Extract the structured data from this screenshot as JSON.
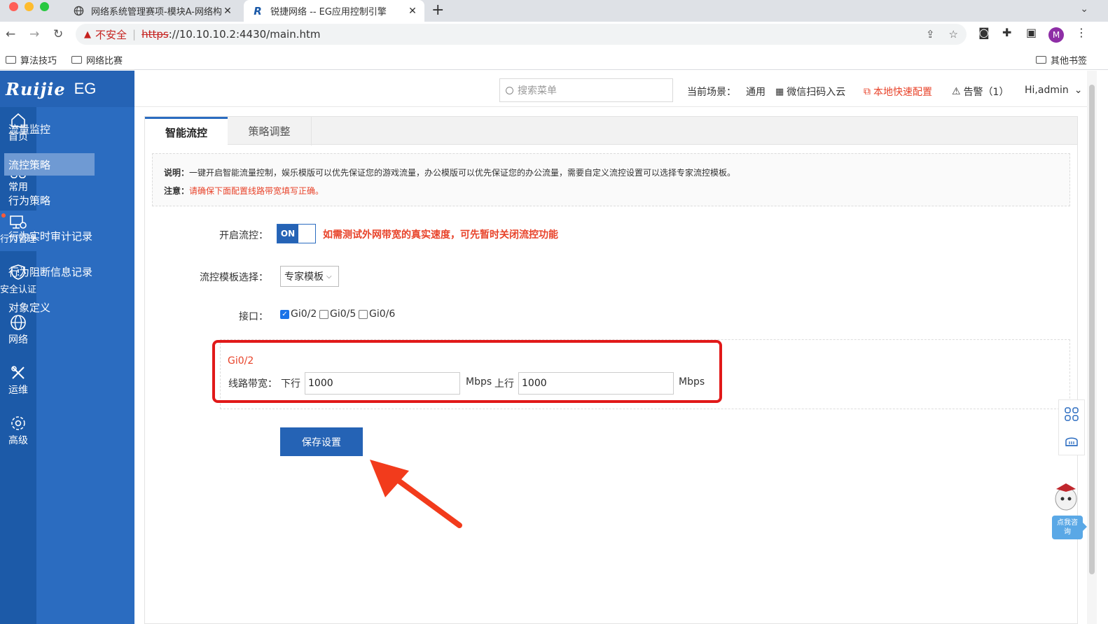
{
  "browser": {
    "tabs": [
      {
        "title": "网络系统管理赛项-模块A-网络构",
        "active": false
      },
      {
        "title": "锐捷网络 -- EG应用控制引擎",
        "active": true
      }
    ],
    "security_label": "不安全",
    "url_scheme": "https",
    "url_rest": "://10.10.10.2:4430/main.htm",
    "avatar_letter": "M",
    "bookmarks": [
      "算法技巧",
      "网络比赛"
    ],
    "other_bookmarks": "其他书签"
  },
  "app": {
    "logo": "Ruijie",
    "product": "EG",
    "accent": "#2563b5",
    "main_nav": [
      {
        "label": "首页",
        "icon": "home-icon"
      },
      {
        "label": "常用",
        "icon": "grid-icon"
      },
      {
        "label": "行为管理",
        "icon": "monitor-icon"
      },
      {
        "label": "安全认证",
        "icon": "shield-icon"
      },
      {
        "label": "网络",
        "icon": "globe-icon"
      },
      {
        "label": "运维",
        "icon": "tools-icon"
      },
      {
        "label": "高级",
        "icon": "gear-icon"
      }
    ],
    "sub_nav": [
      "流量监控",
      "流控策略",
      "行为策略",
      "行为实时审计记录",
      "行为阻断信息记录",
      "对象定义"
    ],
    "sub_nav_active": "流控策略"
  },
  "header": {
    "search_placeholder": "搜索菜单",
    "scene_label": "当前场景：",
    "scene_value": "通用",
    "wechat": "微信扫码入云",
    "quick_config": "本地快速配置",
    "alerts": "告警（1）",
    "user": "Hi,admin"
  },
  "page": {
    "tabs": [
      "智能流控",
      "策略调整"
    ],
    "note_label": "说明：",
    "note_text": "一键开启智能流量控制，娱乐模版可以优先保证您的游戏流量，办公模版可以优先保证您的办公流量，需要自定义流控设置可以选择专家流控模板。",
    "warn_label": "注意：",
    "warn_text": "请确保下面配置线路带宽填写正确。",
    "enable_label": "开启流控：",
    "toggle_state": "ON",
    "toggle_hint": "如需测试外网带宽的真实速度，可先暂时关闭流控功能",
    "template_label": "流控模板选择：",
    "template_value": "专家模板",
    "interface_label": "接口：",
    "interfaces": [
      {
        "name": "Gi0/2",
        "checked": true
      },
      {
        "name": "Gi0/5",
        "checked": false
      },
      {
        "name": "Gi0/6",
        "checked": false
      }
    ],
    "iface_title": "Gi0/2",
    "bandwidth_label": "线路带宽：",
    "down_label": "下行",
    "down_value": "1000",
    "unit1": "Mbps",
    "up_label": "上行",
    "up_value": "1000",
    "unit2": "Mbps",
    "save_label": "保存设置"
  },
  "widget": {
    "consult": "点我咨询"
  }
}
